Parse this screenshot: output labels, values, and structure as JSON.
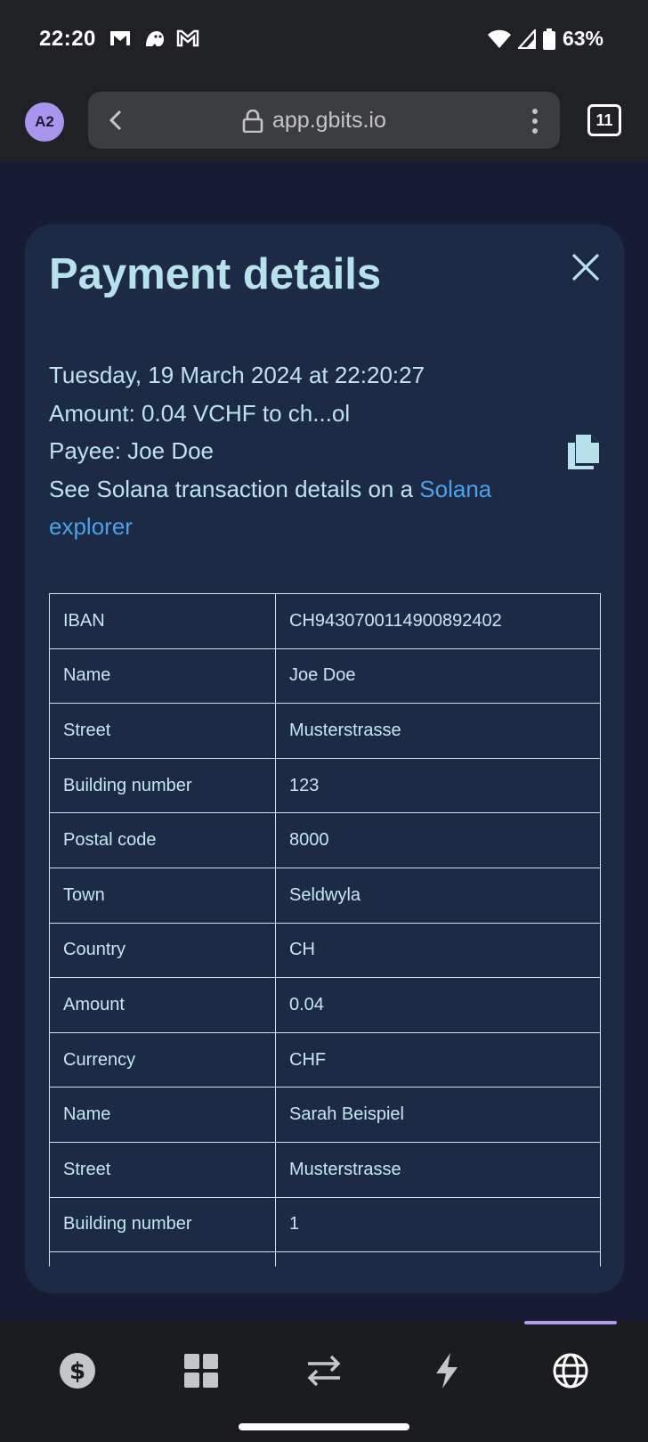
{
  "status_bar": {
    "time": "22:20",
    "battery": "63%",
    "app_icons": [
      "gmail-icon",
      "ghost-app-icon",
      "gmail-icon"
    ]
  },
  "browser": {
    "avatar": "A2",
    "url": "app.gbits.io",
    "tab_count": "11"
  },
  "dialog": {
    "title": "Payment details",
    "date_line": "Tuesday, 19 March 2024 at 22:20:27",
    "amount_line": "Amount: 0.04 VCHF to ch...ol",
    "payee_line": "Payee: Joe Doe",
    "explorer_prefix": "See Solana transaction details on a ",
    "explorer_link": "Solana explorer",
    "rows": [
      {
        "key": "IBAN",
        "value": "CH9430700114900892402"
      },
      {
        "key": "Name",
        "value": "Joe Doe"
      },
      {
        "key": "Street",
        "value": "Musterstrasse"
      },
      {
        "key": "Building number",
        "value": "123"
      },
      {
        "key": "Postal code",
        "value": "8000"
      },
      {
        "key": "Town",
        "value": "Seldwyla"
      },
      {
        "key": "Country",
        "value": "CH"
      },
      {
        "key": "Amount",
        "value": "0.04"
      },
      {
        "key": "Currency",
        "value": "CHF"
      },
      {
        "key": "Name",
        "value": "Sarah Beispiel"
      },
      {
        "key": "Street",
        "value": "Musterstrasse"
      },
      {
        "key": "Building number",
        "value": "1"
      },
      {
        "key": "",
        "value": ""
      }
    ]
  },
  "nav": {
    "items": [
      "dollar-icon",
      "grid-icon",
      "transfer-icon",
      "lightning-icon",
      "globe-icon"
    ],
    "active": "globe-icon",
    "accent_color": "#b199f0"
  },
  "colors": {
    "background": "#171c34",
    "dialog": "#1c2a46",
    "title": "#b8e2eb",
    "link": "#4aa2ea"
  }
}
